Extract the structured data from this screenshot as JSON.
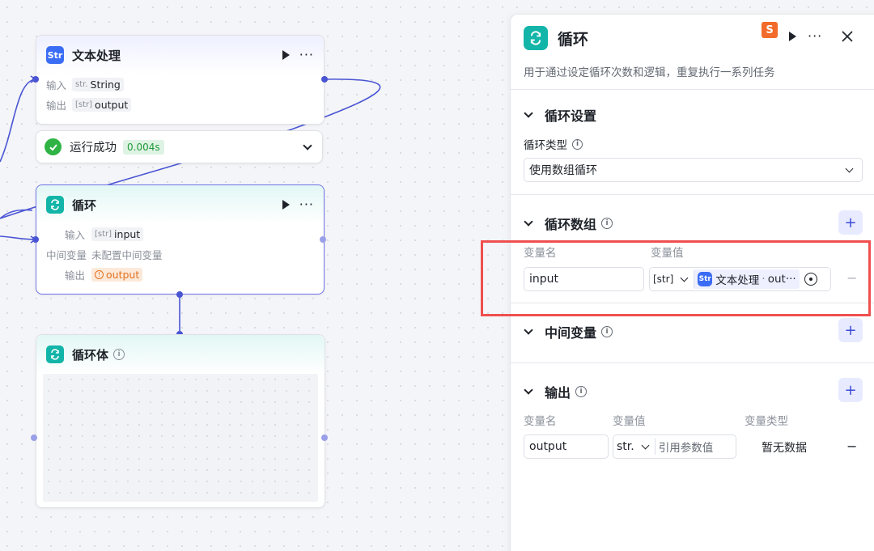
{
  "canvas": {
    "text_node": {
      "title": "文本处理",
      "input_label": "输入",
      "input_type": "str.",
      "input_value": "String",
      "output_label": "输出",
      "output_type": "[str]",
      "output_value": "output"
    },
    "run_status": {
      "text": "运行成功",
      "duration": "0.004s"
    },
    "loop_node": {
      "title": "循环",
      "input_label": "输入",
      "input_type": "[str]",
      "input_value": "input",
      "mid_label": "中间变量",
      "mid_value": "未配置中间变量",
      "output_label": "输出",
      "output_value": "output"
    },
    "loop_body": {
      "title": "循环体"
    }
  },
  "panel": {
    "title": "循环",
    "description": "用于通过设定循环次数和逻辑，重复执行一系列任务",
    "loop_settings": {
      "title": "循环设置",
      "type_label": "循环类型",
      "type_value": "使用数组循环"
    },
    "loop_array": {
      "title": "循环数组",
      "col_name": "变量名",
      "col_value": "变量值",
      "row": {
        "name": "input",
        "type": "[str]",
        "ref_node": "文本处理",
        "ref_var": "out···"
      }
    },
    "intermediate": {
      "title": "中间变量"
    },
    "output": {
      "title": "输出",
      "col_name": "变量名",
      "col_value": "变量值",
      "col_type": "变量类型",
      "row": {
        "name": "output",
        "type": "str.",
        "placeholder": "引用参数值",
        "type_value": "暂无数据"
      }
    }
  },
  "colors": {
    "accent": "#4a55d4",
    "teal": "#12b5a8",
    "highlight": "#ef4f4f",
    "success": "#2fb344"
  }
}
